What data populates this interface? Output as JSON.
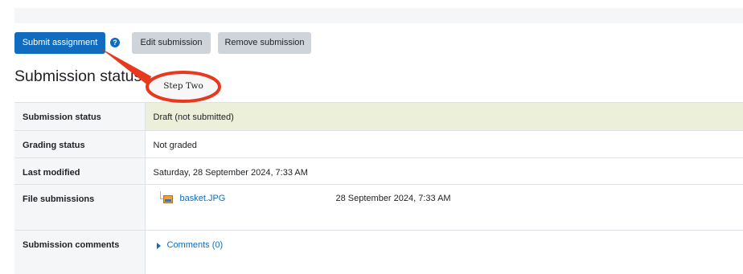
{
  "actions": {
    "submit_label": "Submit assignment",
    "help_glyph": "?",
    "edit_label": "Edit submission",
    "remove_label": "Remove submission"
  },
  "page": {
    "heading": "Submission status"
  },
  "annotation": {
    "label": "Step Two",
    "color": "#e8391e"
  },
  "status_table": {
    "rows": [
      {
        "label": "Submission status",
        "value": "Draft (not submitted)"
      },
      {
        "label": "Grading status",
        "value": "Not graded"
      },
      {
        "label": "Last modified",
        "value": "Saturday, 28 September 2024, 7:33 AM"
      },
      {
        "label": "File submissions",
        "file_name": "basket.JPG",
        "file_date": "28 September 2024, 7:33 AM"
      },
      {
        "label": "Submission comments",
        "comments_link": "Comments (0)"
      }
    ]
  },
  "colors": {
    "primary": "#0f6cbf",
    "secondary": "#ced4da",
    "draft_highlight": "#ecefd9",
    "header_cell": "#f5f6f8"
  }
}
